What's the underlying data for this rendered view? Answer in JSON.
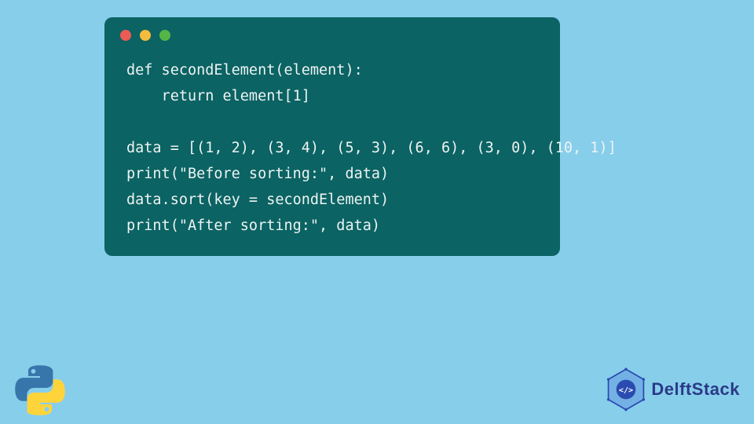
{
  "code": {
    "line1": "def secondElement(element):",
    "line2": "    return element[1]",
    "line3": "",
    "line4": "data = [(1, 2), (3, 4), (5, 3), (6, 6), (3, 0), (10, 1)]",
    "line5": "print(\"Before sorting:\", data)",
    "line6": "data.sort(key = secondElement)",
    "line7": "print(\"After sorting:\", data)"
  },
  "brand": {
    "name": "DelftStack"
  },
  "colors": {
    "bg": "#87ceeb",
    "windowBg": "#0b6363",
    "codeText": "#eef3f3",
    "brandText": "#2a3a87"
  }
}
